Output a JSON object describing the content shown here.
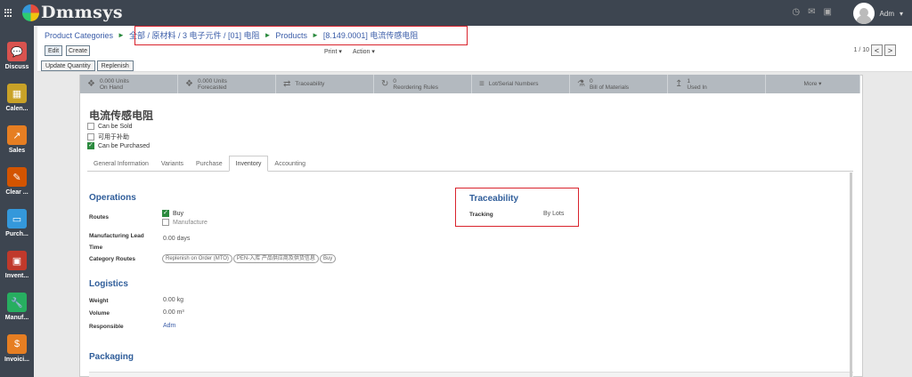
{
  "app": {
    "logo_text": "Dmmsys"
  },
  "topbar": {
    "user_name": "Adm"
  },
  "sidebar": {
    "items": [
      {
        "label": "Discuss",
        "color": "#d9534f",
        "icon": "chat-icon"
      },
      {
        "label": "Calen...",
        "color": "#c9a227",
        "icon": "calendar-icon"
      },
      {
        "label": "Sales",
        "color": "#e67e22",
        "icon": "chart-icon"
      },
      {
        "label": "Clear ...",
        "color": "#d35400",
        "icon": "cleaning-icon"
      },
      {
        "label": "Purch...",
        "color": "#3498db",
        "icon": "card-icon"
      },
      {
        "label": "Invent...",
        "color": "#c0392b",
        "icon": "box-icon"
      },
      {
        "label": "Manuf...",
        "color": "#27ae60",
        "icon": "wrench-icon"
      },
      {
        "label": "Invoici...",
        "color": "#e67e22",
        "icon": "invoice-icon"
      }
    ]
  },
  "breadcrumb": {
    "items": [
      "Product Categories",
      "全部 / 原材料 / 3 电子元件 / [01] 电阻",
      "Products"
    ],
    "active": "[8.149.0001] 电流传感电阻"
  },
  "toolbar": {
    "edit": "Edit",
    "create": "Create",
    "print": "Print",
    "action": "Action",
    "pager": "1 / 10",
    "prev": "<",
    "next": ">"
  },
  "actions": {
    "update_qty": "Update Quantity",
    "replenish": "Replenish"
  },
  "smart_buttons": [
    {
      "icon": "cubes-icon",
      "line1": "0.000 Units",
      "line2": "On Hand"
    },
    {
      "icon": "cubes-icon",
      "line1": "0.000 Units",
      "line2": "Forecasted"
    },
    {
      "icon": "arrows-icon",
      "line1": "Traceability",
      "line2": ""
    },
    {
      "icon": "refresh-icon",
      "line1": "0",
      "line2": "Reordering Rules"
    },
    {
      "icon": "list-icon",
      "line1": "Lot/Serial Numbers",
      "line2": ""
    },
    {
      "icon": "flask-icon",
      "line1": "0",
      "line2": "Bill of Materials"
    },
    {
      "icon": "level-up-icon",
      "line1": "1",
      "line2": "Used In"
    },
    {
      "icon": "",
      "line1": "More ▾",
      "line2": ""
    }
  ],
  "product": {
    "name": "电流传感电阻",
    "checkboxes": [
      {
        "label": "Can be Sold",
        "checked": false
      },
      {
        "label": "可用于补助",
        "checked": false
      },
      {
        "label": "Can be Purchased",
        "checked": true
      }
    ]
  },
  "tabs": [
    "General Information",
    "Variants",
    "Purchase",
    "Inventory",
    "Accounting"
  ],
  "operations": {
    "title": "Operations",
    "routes_label": "Routes",
    "route_buy": "Buy",
    "route_manufacture": "Manufacture",
    "mlt_label": "Manufacturing Lead Time",
    "mlt_value": "0.00 days",
    "cat_routes_label": "Category Routes",
    "cat_routes": [
      "Replenish on Order (MTO)",
      "PEN-入库 产品供应商及供货信息",
      "Buy"
    ]
  },
  "traceability": {
    "title": "Traceability",
    "tracking_label": "Tracking",
    "tracking_value": "By Lots"
  },
  "logistics": {
    "title": "Logistics",
    "weight_label": "Weight",
    "weight_value": "0.00 kg",
    "volume_label": "Volume",
    "volume_value": "0.00 m³",
    "responsible_label": "Responsible",
    "responsible_value": "Adm"
  },
  "packaging": {
    "title": "Packaging"
  }
}
